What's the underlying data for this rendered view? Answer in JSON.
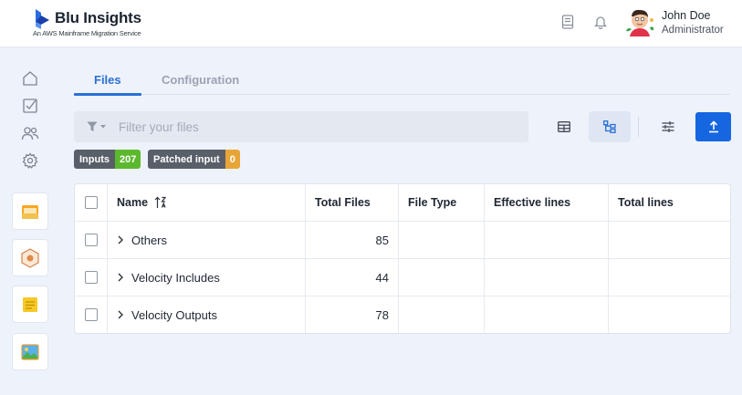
{
  "header": {
    "title": "Blu Insights",
    "subtitle": "An AWS Mainframe Migration Service",
    "user": {
      "name": "John Doe",
      "role": "Administrator"
    },
    "icons": [
      "book-icon",
      "bell-icon"
    ]
  },
  "sidebar": {
    "nav_icons": [
      "home-icon",
      "checklist-icon",
      "users-icon",
      "gear-icon"
    ],
    "apps": [
      "inbox-app-icon",
      "codebase-app-icon",
      "notes-app-icon",
      "image-app-icon"
    ]
  },
  "tabs": [
    {
      "label": "Files",
      "active": true
    },
    {
      "label": "Configuration",
      "active": false
    }
  ],
  "filter": {
    "placeholder": "Filter your files",
    "value": ""
  },
  "toolbar": {
    "view_table_icon": "table-view-icon",
    "view_tree_icon": "tree-view-icon",
    "settings_icon": "sliders-icon",
    "upload_icon": "upload-icon"
  },
  "badges": [
    {
      "label": "Inputs",
      "count": "207",
      "color": "#5cb82d"
    },
    {
      "label": "Patched input",
      "count": "0",
      "color": "#e8a537"
    }
  ],
  "table": {
    "columns": [
      "Name",
      "Total Files",
      "File Type",
      "Effective lines",
      "Total lines"
    ],
    "rows": [
      {
        "name": "Others",
        "total_files": "85",
        "file_type": "",
        "effective_lines": "",
        "total_lines": ""
      },
      {
        "name": "Velocity Includes",
        "total_files": "44",
        "file_type": "",
        "effective_lines": "",
        "total_lines": ""
      },
      {
        "name": "Velocity Outputs",
        "total_files": "78",
        "file_type": "",
        "effective_lines": "",
        "total_lines": ""
      }
    ]
  },
  "colors": {
    "accent": "#2b6fd6",
    "primary_button": "#1566e0",
    "background": "#eef2fa"
  }
}
